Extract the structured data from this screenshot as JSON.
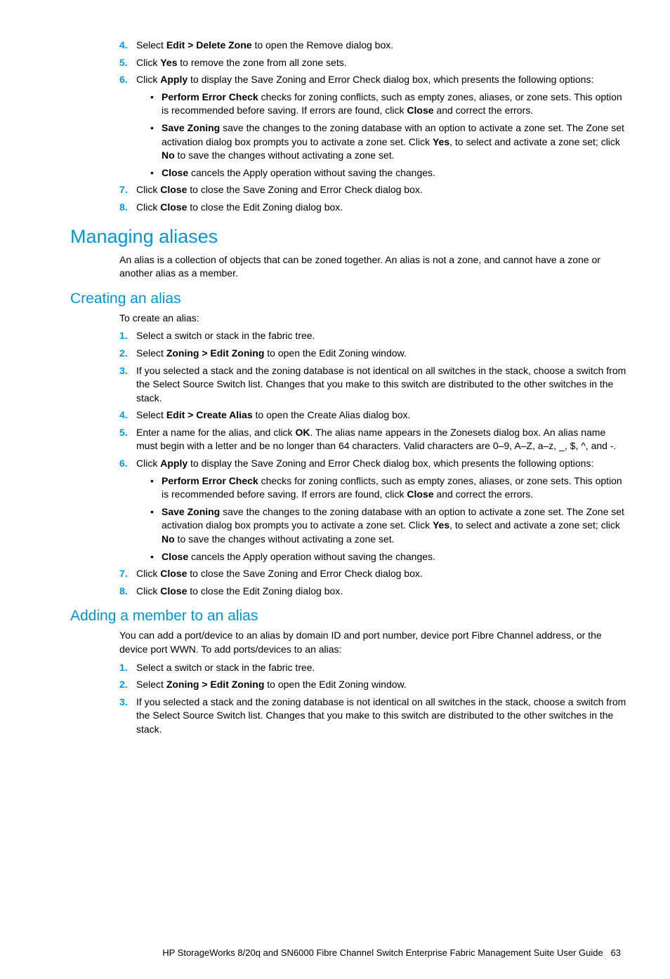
{
  "steps_top": {
    "s4": {
      "num": "4.",
      "a": "Select ",
      "b": "Edit > Delete Zone",
      "c": " to open the Remove dialog box."
    },
    "s5": {
      "num": "5.",
      "a": "Click ",
      "b": "Yes",
      "c": " to remove the zone from all zone sets."
    },
    "s6": {
      "num": "6.",
      "a": "Click ",
      "b": "Apply",
      "c": " to display the Save Zoning and Error Check dialog box, which presents the following options:"
    },
    "s6_opts": {
      "o1": {
        "b": "Perform Error Check",
        "t1": " checks for zoning conflicts, such as empty zones, aliases, or zone sets. This option is recommended before saving. If errors are found, click ",
        "b2": "Close",
        "t2": " and correct the errors."
      },
      "o2": {
        "b": "Save Zoning",
        "t1": " save the changes to the zoning database with an option to activate a zone set. The Zone set activation dialog box prompts you to activate a zone set. Click ",
        "b2": "Yes",
        "t2": ", to select and activate a zone set; click ",
        "b3": "No",
        "t3": " to save the changes without activating a zone set."
      },
      "o3": {
        "b": "Close",
        "t1": " cancels the Apply operation without saving the changes."
      }
    },
    "s7": {
      "num": "7.",
      "a": "Click ",
      "b": "Close",
      "c": " to close the Save Zoning and Error Check dialog box."
    },
    "s8": {
      "num": "8.",
      "a": "Click ",
      "b": "Close",
      "c": " to close the Edit Zoning dialog box."
    }
  },
  "h1": "Managing aliases",
  "p1": "An alias is a collection of objects that can be zoned together. An alias is not a zone, and cannot have a zone or another alias as a member.",
  "h2a": "Creating an alias",
  "p2": "To create an alias:",
  "create_steps": {
    "s1": {
      "num": "1.",
      "t": "Select a switch or stack in the fabric tree."
    },
    "s2": {
      "num": "2.",
      "a": "Select ",
      "b": "Zoning > Edit Zoning",
      "c": " to open the Edit Zoning window."
    },
    "s3": {
      "num": "3.",
      "t": "If you selected a stack and the zoning database is not identical on all switches in the stack, choose a switch from the Select Source Switch list. Changes that you make to this switch are distributed to the other switches in the stack."
    },
    "s4": {
      "num": "4.",
      "a": "Select ",
      "b": "Edit > Create Alias",
      "c": " to open the Create Alias dialog box."
    },
    "s5": {
      "num": "5.",
      "a": "Enter a name for the alias, and click ",
      "b": "OK",
      "c": ". The alias name appears in the Zonesets dialog box. An alias name must begin with a letter and be no longer than 64 characters. Valid characters are 0–9, A–Z, a–z, _, $, ^, and -."
    },
    "s6": {
      "num": "6.",
      "a": "Click ",
      "b": "Apply",
      "c": " to display the Save Zoning and Error Check dialog box, which presents the following options:"
    },
    "s6_opts": {
      "o1": {
        "b": "Perform Error Check",
        "t1": " checks for zoning conflicts, such as empty zones, aliases, or zone sets. This option is recommended before saving. If errors are found, click ",
        "b2": "Close",
        "t2": " and correct the errors."
      },
      "o2": {
        "b": "Save Zoning",
        "t1": " save the changes to the zoning database with an option to activate a zone set. The Zone set activation dialog box prompts you to activate a zone set. Click ",
        "b2": "Yes",
        "t2": ", to select and activate a zone set; click ",
        "b3": "No",
        "t3": " to save the changes without activating a zone set."
      },
      "o3": {
        "b": "Close",
        "t1": " cancels the Apply operation without saving the changes."
      }
    },
    "s7": {
      "num": "7.",
      "a": "Click ",
      "b": "Close",
      "c": " to close the Save Zoning and Error Check dialog box."
    },
    "s8": {
      "num": "8.",
      "a": "Click ",
      "b": "Close",
      "c": " to close the Edit Zoning dialog box."
    }
  },
  "h2b": "Adding a member to an alias",
  "p3": "You can add a port/device to an alias by domain ID and port number, device port Fibre Channel address, or the device port WWN. To add ports/devices to an alias:",
  "add_steps": {
    "s1": {
      "num": "1.",
      "t": "Select a switch or stack in the fabric tree."
    },
    "s2": {
      "num": "2.",
      "a": "Select ",
      "b": "Zoning > Edit Zoning",
      "c": " to open the Edit Zoning window."
    },
    "s3": {
      "num": "3.",
      "t": "If you selected a stack and the zoning database is not identical on all switches in the stack, choose a switch from the Select Source Switch list. Changes that you make to this switch are distributed to the other switches in the stack."
    }
  },
  "footer": {
    "text": "HP StorageWorks 8/20q and SN6000 Fibre Channel Switch Enterprise Fabric Management Suite User Guide",
    "page": "63"
  }
}
